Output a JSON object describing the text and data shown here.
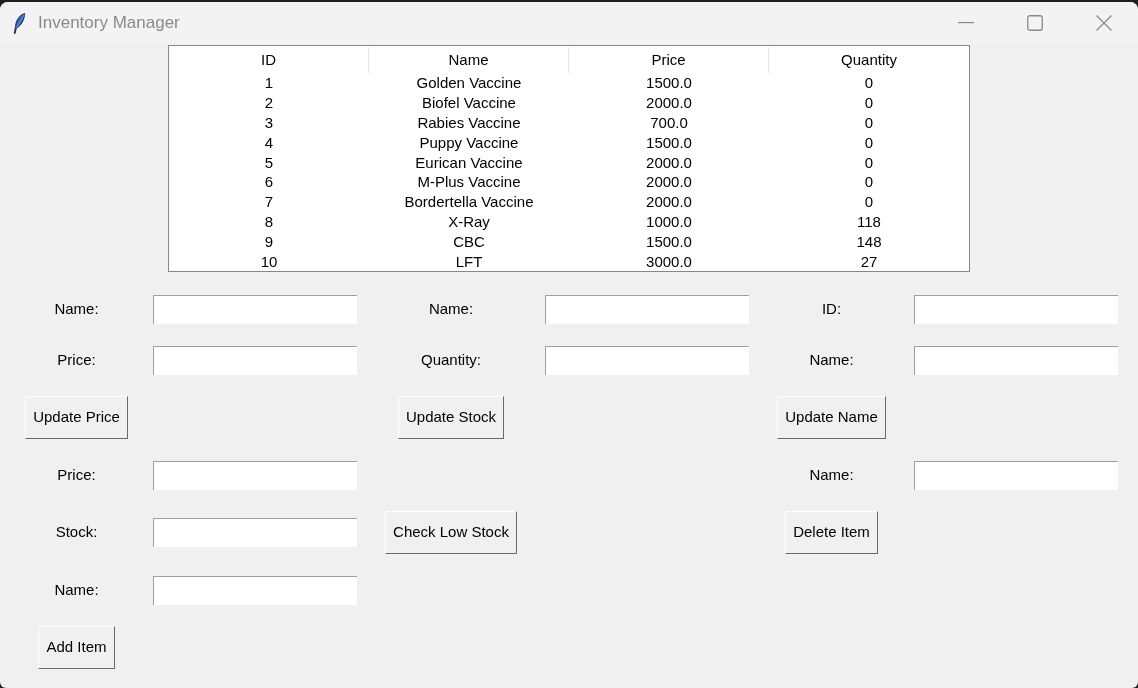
{
  "window": {
    "title": "Inventory Manager"
  },
  "table": {
    "columns": [
      "ID",
      "Name",
      "Price",
      "Quantity"
    ],
    "rows": [
      [
        "1",
        "Golden Vaccine",
        "1500.0",
        "0"
      ],
      [
        "2",
        "Biofel Vaccine",
        "2000.0",
        "0"
      ],
      [
        "3",
        "Rabies Vaccine",
        "700.0",
        "0"
      ],
      [
        "4",
        "Puppy Vaccine",
        "1500.0",
        "0"
      ],
      [
        "5",
        "Eurican Vaccine",
        "2000.0",
        "0"
      ],
      [
        "6",
        "M-Plus Vaccine",
        "2000.0",
        "0"
      ],
      [
        "7",
        "Bordertella Vaccine",
        "2000.0",
        "0"
      ],
      [
        "8",
        "X-Ray",
        "1000.0",
        "118"
      ],
      [
        "9",
        "CBC",
        "1500.0",
        "148"
      ],
      [
        "10",
        "LFT",
        "3000.0",
        "27"
      ]
    ]
  },
  "form": {
    "rows": [
      [
        {
          "kind": "label",
          "text": "Name:"
        },
        {
          "kind": "entry"
        },
        {
          "kind": "label",
          "text": "Name:"
        },
        {
          "kind": "entry"
        },
        {
          "kind": "label",
          "text": "ID:"
        },
        {
          "kind": "entry"
        }
      ],
      [
        {
          "kind": "label",
          "text": "Price:"
        },
        {
          "kind": "entry"
        },
        {
          "kind": "label",
          "text": "Quantity:"
        },
        {
          "kind": "entry"
        },
        {
          "kind": "label",
          "text": "Name:"
        },
        {
          "kind": "entry"
        }
      ],
      [
        {
          "kind": "button",
          "text": "Update Price"
        },
        {
          "kind": "blank"
        },
        {
          "kind": "button",
          "text": "Update Stock"
        },
        {
          "kind": "blank"
        },
        {
          "kind": "button",
          "text": "Update Name"
        }
      ],
      [
        {
          "kind": "label",
          "text": "Price:"
        },
        {
          "kind": "entry"
        },
        {
          "kind": "blank"
        },
        {
          "kind": "blank"
        },
        {
          "kind": "label",
          "text": "Name:"
        },
        {
          "kind": "entry"
        }
      ],
      [
        {
          "kind": "label",
          "text": "Stock:"
        },
        {
          "kind": "entry"
        },
        {
          "kind": "button",
          "text": "Check Low Stock"
        },
        {
          "kind": "blank"
        },
        {
          "kind": "button",
          "text": "Delete Item"
        }
      ],
      [
        {
          "kind": "label",
          "text": "Name:"
        },
        {
          "kind": "entry"
        }
      ],
      [
        {
          "kind": "button",
          "text": "Add Item"
        }
      ]
    ]
  }
}
